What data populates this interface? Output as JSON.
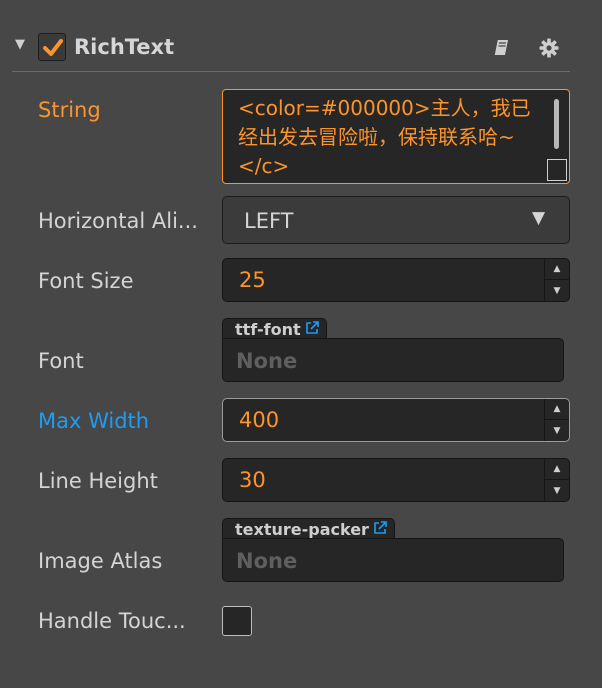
{
  "component": {
    "title": "RichText",
    "enabled": true,
    "collapse_icon": "triangle-down-icon",
    "help_icon": "book-icon",
    "settings_icon": "gear-icon"
  },
  "properties": {
    "string": {
      "label": "String",
      "value": "<color=#000000>主人，我已经出发去冒险啦，保持联系哈~</c>"
    },
    "horizontal_align": {
      "label": "Horizontal Ali...",
      "value": "LEFT"
    },
    "font_size": {
      "label": "Font Size",
      "value": "25"
    },
    "font": {
      "label": "Font",
      "asset_type": "ttf-font",
      "value": "None"
    },
    "max_width": {
      "label": "Max Width",
      "value": "400"
    },
    "line_height": {
      "label": "Line Height",
      "value": "30"
    },
    "image_atlas": {
      "label": "Image Atlas",
      "asset_type": "texture-packer",
      "value": "None"
    },
    "handle_touch": {
      "label": "Handle Touc...",
      "checked": false
    }
  },
  "colors": {
    "panel_bg": "#474747",
    "field_bg": "#262626",
    "accent_orange": "#fd942b",
    "accent_blue": "#1f9cf2"
  }
}
